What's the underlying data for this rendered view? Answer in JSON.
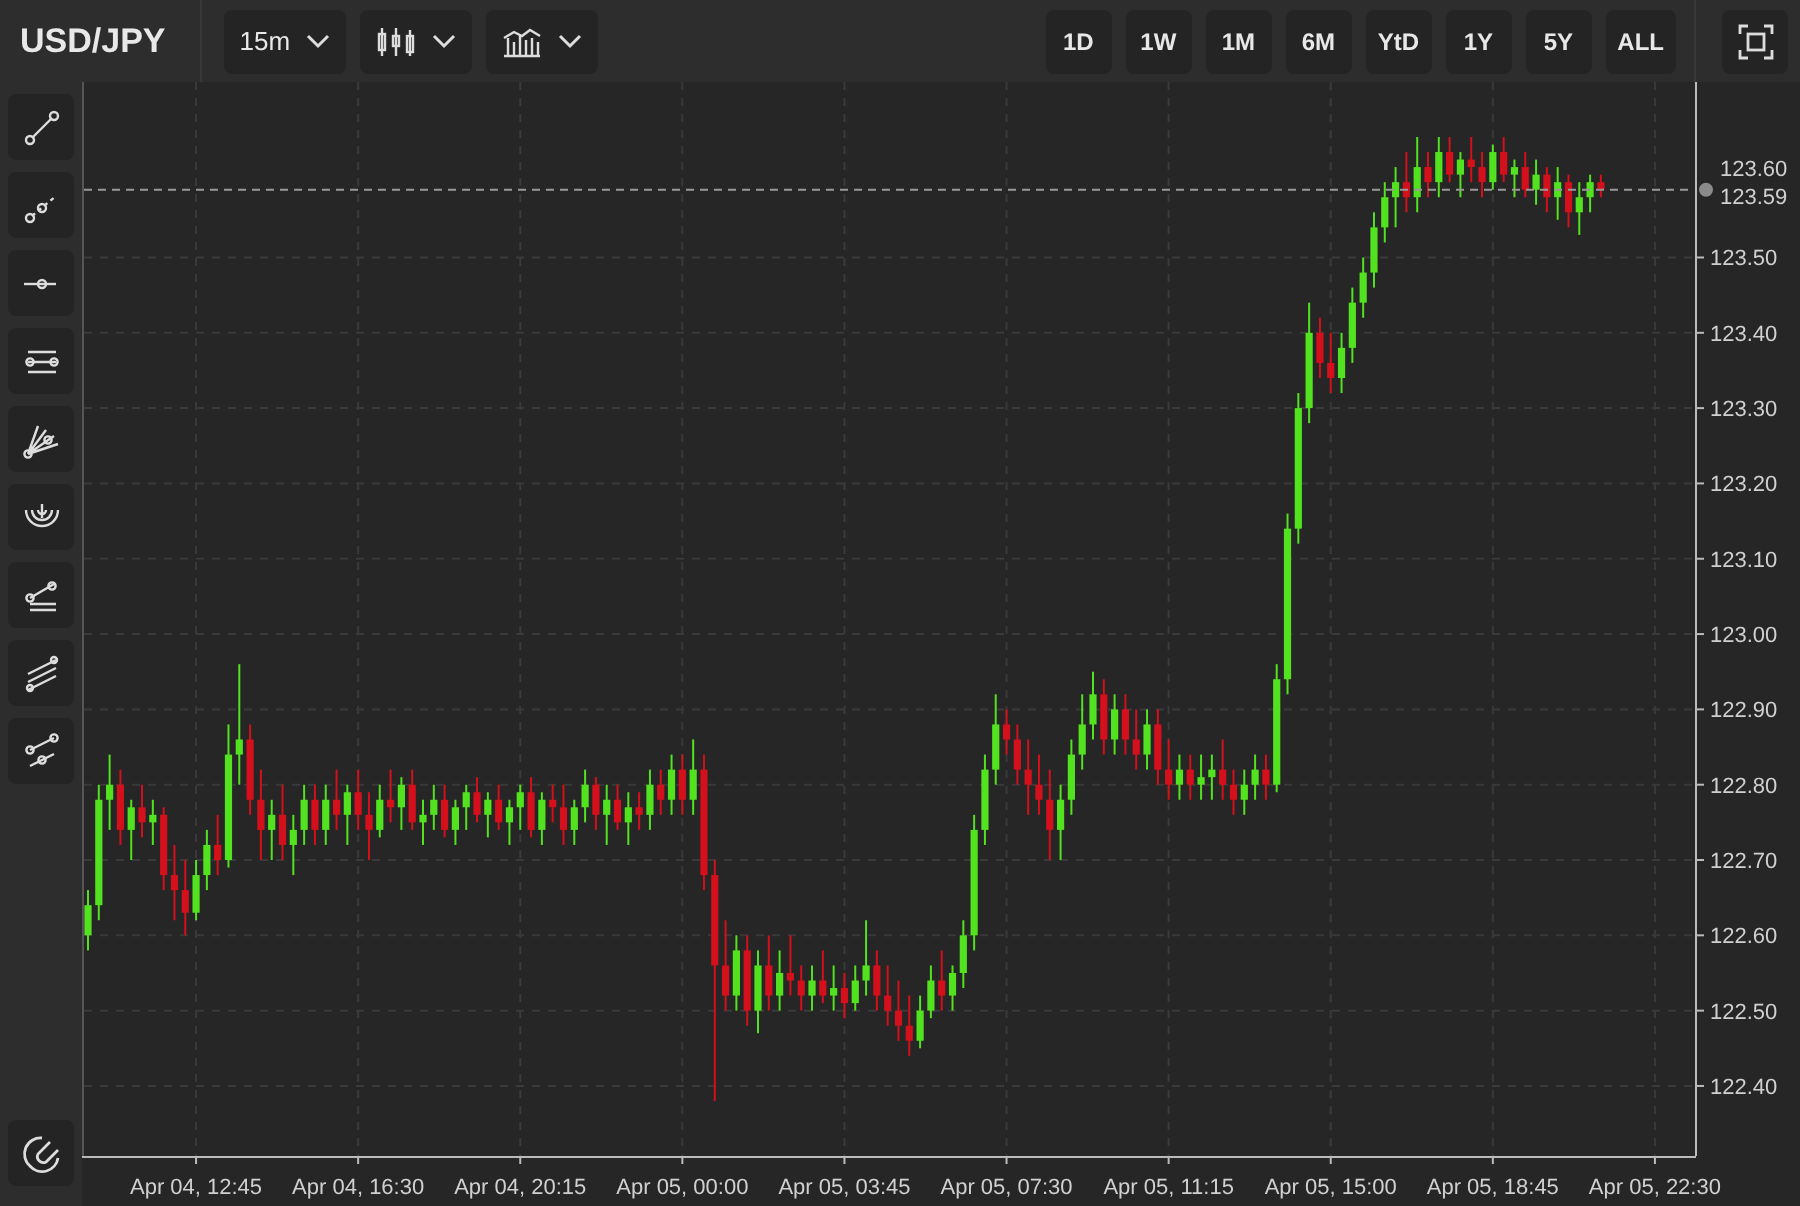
{
  "symbol": "USD/JPY",
  "toolbar": {
    "interval": "15m",
    "ranges": [
      {
        "label": "1D",
        "selected": false
      },
      {
        "label": "1W",
        "selected": false
      },
      {
        "label": "1M",
        "selected": false
      },
      {
        "label": "6M",
        "selected": false
      },
      {
        "label": "YtD",
        "selected": false
      },
      {
        "label": "1Y",
        "selected": false
      },
      {
        "label": "5Y",
        "selected": false
      },
      {
        "label": "ALL",
        "selected": false
      }
    ]
  },
  "chart": {
    "price_label": "123.60",
    "chart_data": {
      "type": "candlestick",
      "categories": [
        null,
        null,
        null,
        null,
        null,
        null,
        null,
        null,
        null,
        null,
        "Apr 04, 12:45",
        null,
        null,
        null,
        null,
        null,
        null,
        null,
        null,
        null,
        null,
        null,
        null,
        null,
        null,
        "Apr 04, 16:30",
        null,
        null,
        null,
        null,
        null,
        null,
        null,
        null,
        null,
        null,
        null,
        null,
        null,
        null,
        "Apr 04, 20:15",
        null,
        null,
        null,
        null,
        null,
        null,
        null,
        null,
        null,
        null,
        null,
        null,
        null,
        null,
        "Apr 05, 00:00",
        null,
        null,
        null,
        null,
        null,
        null,
        null,
        null,
        null,
        null,
        null,
        null,
        null,
        null,
        "Apr 05, 03:45",
        null,
        null,
        null,
        null,
        null,
        null,
        null,
        null,
        null,
        null,
        null,
        null,
        null,
        null,
        "Apr 05, 07:30",
        null,
        null,
        null,
        null,
        null,
        null,
        null,
        null,
        null,
        null,
        null,
        null,
        null,
        null,
        "Apr 05, 11:15",
        null,
        null,
        null,
        null,
        null,
        null,
        null,
        null,
        null,
        null,
        null,
        null,
        null,
        null,
        "Apr 05, 15:00",
        null,
        null,
        null,
        null,
        null,
        null,
        null,
        null,
        null,
        null,
        null,
        null,
        null,
        null,
        "Apr 05, 18:45",
        null,
        null,
        null,
        null,
        null,
        null,
        null,
        null,
        null,
        null,
        null,
        null,
        null,
        null,
        "Apr 05, 22:30"
      ],
      "ohlc": [
        [
          122.6,
          122.66,
          122.58,
          122.64
        ],
        [
          122.64,
          122.8,
          122.62,
          122.78
        ],
        [
          122.78,
          122.84,
          122.74,
          122.8
        ],
        [
          122.8,
          122.82,
          122.72,
          122.74
        ],
        [
          122.74,
          122.78,
          122.7,
          122.77
        ],
        [
          122.77,
          122.8,
          122.73,
          122.75
        ],
        [
          122.75,
          122.78,
          122.72,
          122.76
        ],
        [
          122.76,
          122.77,
          122.66,
          122.68
        ],
        [
          122.68,
          122.72,
          122.62,
          122.66
        ],
        [
          122.66,
          122.7,
          122.6,
          122.63
        ],
        [
          122.63,
          122.7,
          122.62,
          122.68
        ],
        [
          122.68,
          122.74,
          122.66,
          122.72
        ],
        [
          122.72,
          122.76,
          122.68,
          122.7
        ],
        [
          122.7,
          122.88,
          122.69,
          122.84
        ],
        [
          122.84,
          122.96,
          122.8,
          122.86
        ],
        [
          122.86,
          122.88,
          122.76,
          122.78
        ],
        [
          122.78,
          122.82,
          122.7,
          122.74
        ],
        [
          122.74,
          122.78,
          122.7,
          122.76
        ],
        [
          122.76,
          122.8,
          122.7,
          122.72
        ],
        [
          122.72,
          122.76,
          122.68,
          122.74
        ],
        [
          122.74,
          122.8,
          122.72,
          122.78
        ],
        [
          122.78,
          122.8,
          122.72,
          122.74
        ],
        [
          122.74,
          122.8,
          122.72,
          122.78
        ],
        [
          122.78,
          122.82,
          122.74,
          122.76
        ],
        [
          122.76,
          122.8,
          122.72,
          122.79
        ],
        [
          122.79,
          122.82,
          122.74,
          122.76
        ],
        [
          122.76,
          122.79,
          122.7,
          122.74
        ],
        [
          122.74,
          122.8,
          122.73,
          122.78
        ],
        [
          122.78,
          122.82,
          122.75,
          122.77
        ],
        [
          122.77,
          122.81,
          122.74,
          122.8
        ],
        [
          122.8,
          122.82,
          122.74,
          122.75
        ],
        [
          122.75,
          122.78,
          122.72,
          122.76
        ],
        [
          122.76,
          122.8,
          122.74,
          122.78
        ],
        [
          122.78,
          122.8,
          122.73,
          122.74
        ],
        [
          122.74,
          122.78,
          122.72,
          122.77
        ],
        [
          122.77,
          122.8,
          122.74,
          122.79
        ],
        [
          122.79,
          122.81,
          122.75,
          122.76
        ],
        [
          122.76,
          122.79,
          122.73,
          122.78
        ],
        [
          122.78,
          122.8,
          122.74,
          122.75
        ],
        [
          122.75,
          122.78,
          122.72,
          122.77
        ],
        [
          122.77,
          122.8,
          122.74,
          122.79
        ],
        [
          122.79,
          122.81,
          122.73,
          122.74
        ],
        [
          122.74,
          122.79,
          122.72,
          122.78
        ],
        [
          122.78,
          122.8,
          122.75,
          122.77
        ],
        [
          122.77,
          122.8,
          122.72,
          122.74
        ],
        [
          122.74,
          122.78,
          122.72,
          122.77
        ],
        [
          122.77,
          122.82,
          122.75,
          122.8
        ],
        [
          122.8,
          122.81,
          122.74,
          122.76
        ],
        [
          122.76,
          122.8,
          122.72,
          122.78
        ],
        [
          122.78,
          122.8,
          122.74,
          122.75
        ],
        [
          122.75,
          122.79,
          122.72,
          122.77
        ],
        [
          122.77,
          122.79,
          122.74,
          122.76
        ],
        [
          122.76,
          122.82,
          122.74,
          122.8
        ],
        [
          122.8,
          122.82,
          122.76,
          122.78
        ],
        [
          122.78,
          122.84,
          122.76,
          122.82
        ],
        [
          122.82,
          122.84,
          122.76,
          122.78
        ],
        [
          122.78,
          122.86,
          122.76,
          122.82
        ],
        [
          122.82,
          122.84,
          122.66,
          122.68
        ],
        [
          122.68,
          122.7,
          122.38,
          122.56
        ],
        [
          122.56,
          122.62,
          122.5,
          122.52
        ],
        [
          122.52,
          122.6,
          122.5,
          122.58
        ],
        [
          122.58,
          122.6,
          122.48,
          122.5
        ],
        [
          122.5,
          122.58,
          122.47,
          122.56
        ],
        [
          122.56,
          122.6,
          122.5,
          122.52
        ],
        [
          122.52,
          122.58,
          122.5,
          122.55
        ],
        [
          122.55,
          122.6,
          122.52,
          122.54
        ],
        [
          122.54,
          122.56,
          122.5,
          122.52
        ],
        [
          122.52,
          122.56,
          122.5,
          122.54
        ],
        [
          122.54,
          122.58,
          122.51,
          122.52
        ],
        [
          122.52,
          122.56,
          122.5,
          122.53
        ],
        [
          122.53,
          122.55,
          122.49,
          122.51
        ],
        [
          122.51,
          122.56,
          122.5,
          122.54
        ],
        [
          122.54,
          122.62,
          122.52,
          122.56
        ],
        [
          122.56,
          122.58,
          122.5,
          122.52
        ],
        [
          122.52,
          122.56,
          122.48,
          122.5
        ],
        [
          122.5,
          122.54,
          122.46,
          122.48
        ],
        [
          122.48,
          122.52,
          122.44,
          122.46
        ],
        [
          122.46,
          122.52,
          122.45,
          122.5
        ],
        [
          122.5,
          122.56,
          122.49,
          122.54
        ],
        [
          122.54,
          122.58,
          122.5,
          122.52
        ],
        [
          122.52,
          122.56,
          122.5,
          122.55
        ],
        [
          122.55,
          122.62,
          122.53,
          122.6
        ],
        [
          122.6,
          122.76,
          122.58,
          122.74
        ],
        [
          122.74,
          122.84,
          122.72,
          122.82
        ],
        [
          122.82,
          122.92,
          122.8,
          122.88
        ],
        [
          122.88,
          122.9,
          122.84,
          122.86
        ],
        [
          122.86,
          122.88,
          122.8,
          122.82
        ],
        [
          122.82,
          122.86,
          122.76,
          122.8
        ],
        [
          122.8,
          122.84,
          122.76,
          122.78
        ],
        [
          122.78,
          122.82,
          122.7,
          122.74
        ],
        [
          122.74,
          122.8,
          122.7,
          122.78
        ],
        [
          122.78,
          122.86,
          122.76,
          122.84
        ],
        [
          122.84,
          122.92,
          122.82,
          122.88
        ],
        [
          122.88,
          122.95,
          122.86,
          122.92
        ],
        [
          122.92,
          122.94,
          122.84,
          122.86
        ],
        [
          122.86,
          122.92,
          122.84,
          122.9
        ],
        [
          122.9,
          122.92,
          122.84,
          122.86
        ],
        [
          122.86,
          122.9,
          122.82,
          122.84
        ],
        [
          122.84,
          122.9,
          122.82,
          122.88
        ],
        [
          122.88,
          122.9,
          122.8,
          122.82
        ],
        [
          122.82,
          122.86,
          122.78,
          122.8
        ],
        [
          122.8,
          122.84,
          122.78,
          122.82
        ],
        [
          122.82,
          122.84,
          122.78,
          122.8
        ],
        [
          122.8,
          122.84,
          122.78,
          122.81
        ],
        [
          122.81,
          122.84,
          122.78,
          122.82
        ],
        [
          122.82,
          122.86,
          122.78,
          122.8
        ],
        [
          122.8,
          122.82,
          122.76,
          122.78
        ],
        [
          122.78,
          122.82,
          122.76,
          122.8
        ],
        [
          122.8,
          122.84,
          122.78,
          122.82
        ],
        [
          122.82,
          122.84,
          122.78,
          122.8
        ],
        [
          122.8,
          122.96,
          122.79,
          122.94
        ],
        [
          122.94,
          123.16,
          122.92,
          123.14
        ],
        [
          123.14,
          123.32,
          123.12,
          123.3
        ],
        [
          123.3,
          123.44,
          123.28,
          123.4
        ],
        [
          123.4,
          123.42,
          123.34,
          123.36
        ],
        [
          123.36,
          123.4,
          123.32,
          123.34
        ],
        [
          123.34,
          123.4,
          123.32,
          123.38
        ],
        [
          123.38,
          123.46,
          123.36,
          123.44
        ],
        [
          123.44,
          123.5,
          123.42,
          123.48
        ],
        [
          123.48,
          123.56,
          123.46,
          123.54
        ],
        [
          123.54,
          123.6,
          123.52,
          123.58
        ],
        [
          123.58,
          123.62,
          123.54,
          123.6
        ],
        [
          123.6,
          123.64,
          123.56,
          123.58
        ],
        [
          123.58,
          123.66,
          123.56,
          123.62
        ],
        [
          123.62,
          123.64,
          123.58,
          123.6
        ],
        [
          123.6,
          123.66,
          123.58,
          123.64
        ],
        [
          123.64,
          123.66,
          123.6,
          123.61
        ],
        [
          123.61,
          123.64,
          123.58,
          123.63
        ],
        [
          123.63,
          123.66,
          123.6,
          123.62
        ],
        [
          123.62,
          123.64,
          123.58,
          123.6
        ],
        [
          123.6,
          123.65,
          123.59,
          123.64
        ],
        [
          123.64,
          123.66,
          123.6,
          123.61
        ],
        [
          123.61,
          123.63,
          123.58,
          123.62
        ],
        [
          123.62,
          123.64,
          123.58,
          123.59
        ],
        [
          123.59,
          123.63,
          123.57,
          123.61
        ],
        [
          123.61,
          123.62,
          123.56,
          123.58
        ],
        [
          123.58,
          123.62,
          123.55,
          123.6
        ],
        [
          123.6,
          123.61,
          123.54,
          123.56
        ],
        [
          123.56,
          123.6,
          123.53,
          123.58
        ],
        [
          123.58,
          123.61,
          123.56,
          123.6
        ],
        [
          123.6,
          123.61,
          123.58,
          123.59
        ],
        null,
        null,
        null,
        null,
        null
      ],
      "ylim": [
        122.307,
        123.733
      ],
      "grid": true,
      "ref_lines": [
        {
          "axis": "y",
          "value": 123.59,
          "label": "123.59"
        }
      ],
      "yticks": [
        {
          "value": 123.5,
          "label": "123.50"
        },
        {
          "value": 123.4,
          "label": "123.40"
        },
        {
          "value": 123.3,
          "label": "123.30"
        },
        {
          "value": 123.2,
          "label": "123.20"
        },
        {
          "value": 123.1,
          "label": "123.10"
        },
        {
          "value": 123.0,
          "label": "123.00"
        },
        {
          "value": 122.9,
          "label": "122.90"
        },
        {
          "value": 122.8,
          "label": "122.80"
        },
        {
          "value": 122.7,
          "label": "122.70"
        },
        {
          "value": 122.6,
          "label": "122.60"
        },
        {
          "value": 122.5,
          "label": "122.50"
        },
        {
          "value": 122.4,
          "label": "122.40"
        }
      ]
    }
  }
}
